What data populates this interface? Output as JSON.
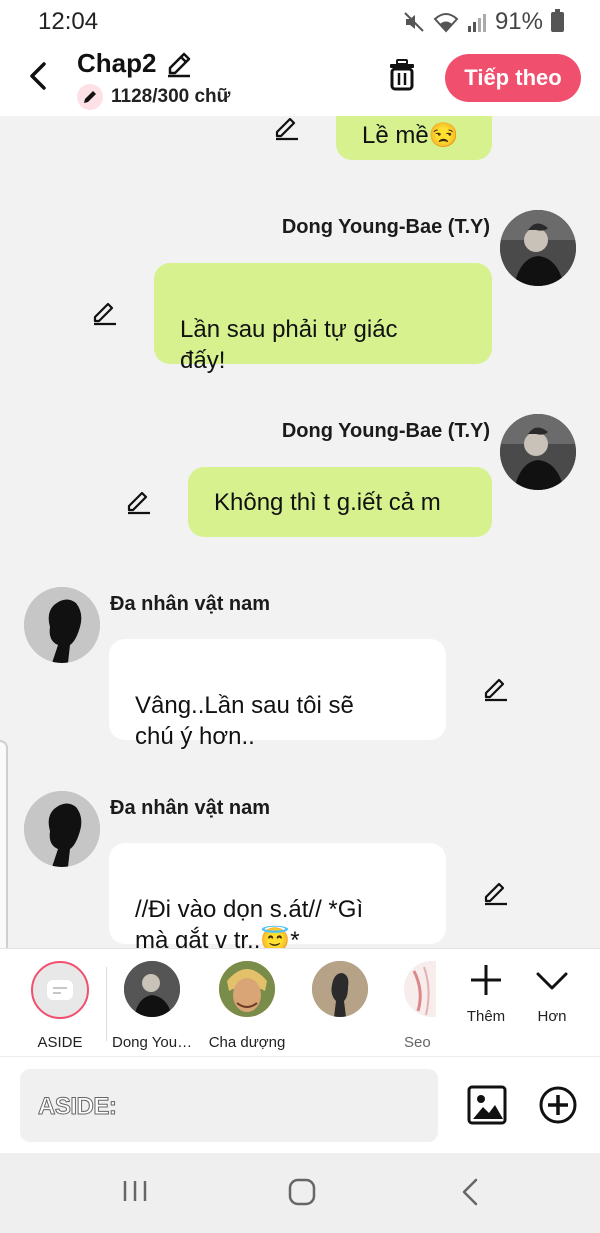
{
  "status_bar": {
    "time": "12:04",
    "battery": "91%"
  },
  "header": {
    "title": "Chap2",
    "word_count": "1128/300 chữ",
    "next_label": "Tiếp theo"
  },
  "messages": [
    {
      "name": "",
      "text": "Lề mề😒",
      "side": "right"
    },
    {
      "name": "Dong Young-Bae (T.Y)",
      "text": "Lần sau phải tự giác\nđấy!",
      "side": "right"
    },
    {
      "name": "Dong Young-Bae (T.Y)",
      "text": "Không thì t g.iết cả m",
      "side": "right"
    },
    {
      "name": "Đa nhân vật nam",
      "text": "Vâng..Lần sau tôi sẽ\nchú ý hơn..",
      "side": "left"
    },
    {
      "name": "Đa nhân vật nam",
      "text": "//Đi vào dọn s.át// *Gì\nmà gắt v tr..😇*",
      "side": "left"
    }
  ],
  "characters": [
    {
      "label": "ASIDE"
    },
    {
      "label": "Dong You…"
    },
    {
      "label": "Cha dượng"
    },
    {
      "label": ""
    },
    {
      "label": "Seo"
    }
  ],
  "tools": {
    "add_label": "Thêm",
    "more_label": "Hơn"
  },
  "input": {
    "placeholder": "ASIDE:"
  },
  "colors": {
    "accent": "#f0506e",
    "bubble_green": "#d6f18e"
  }
}
